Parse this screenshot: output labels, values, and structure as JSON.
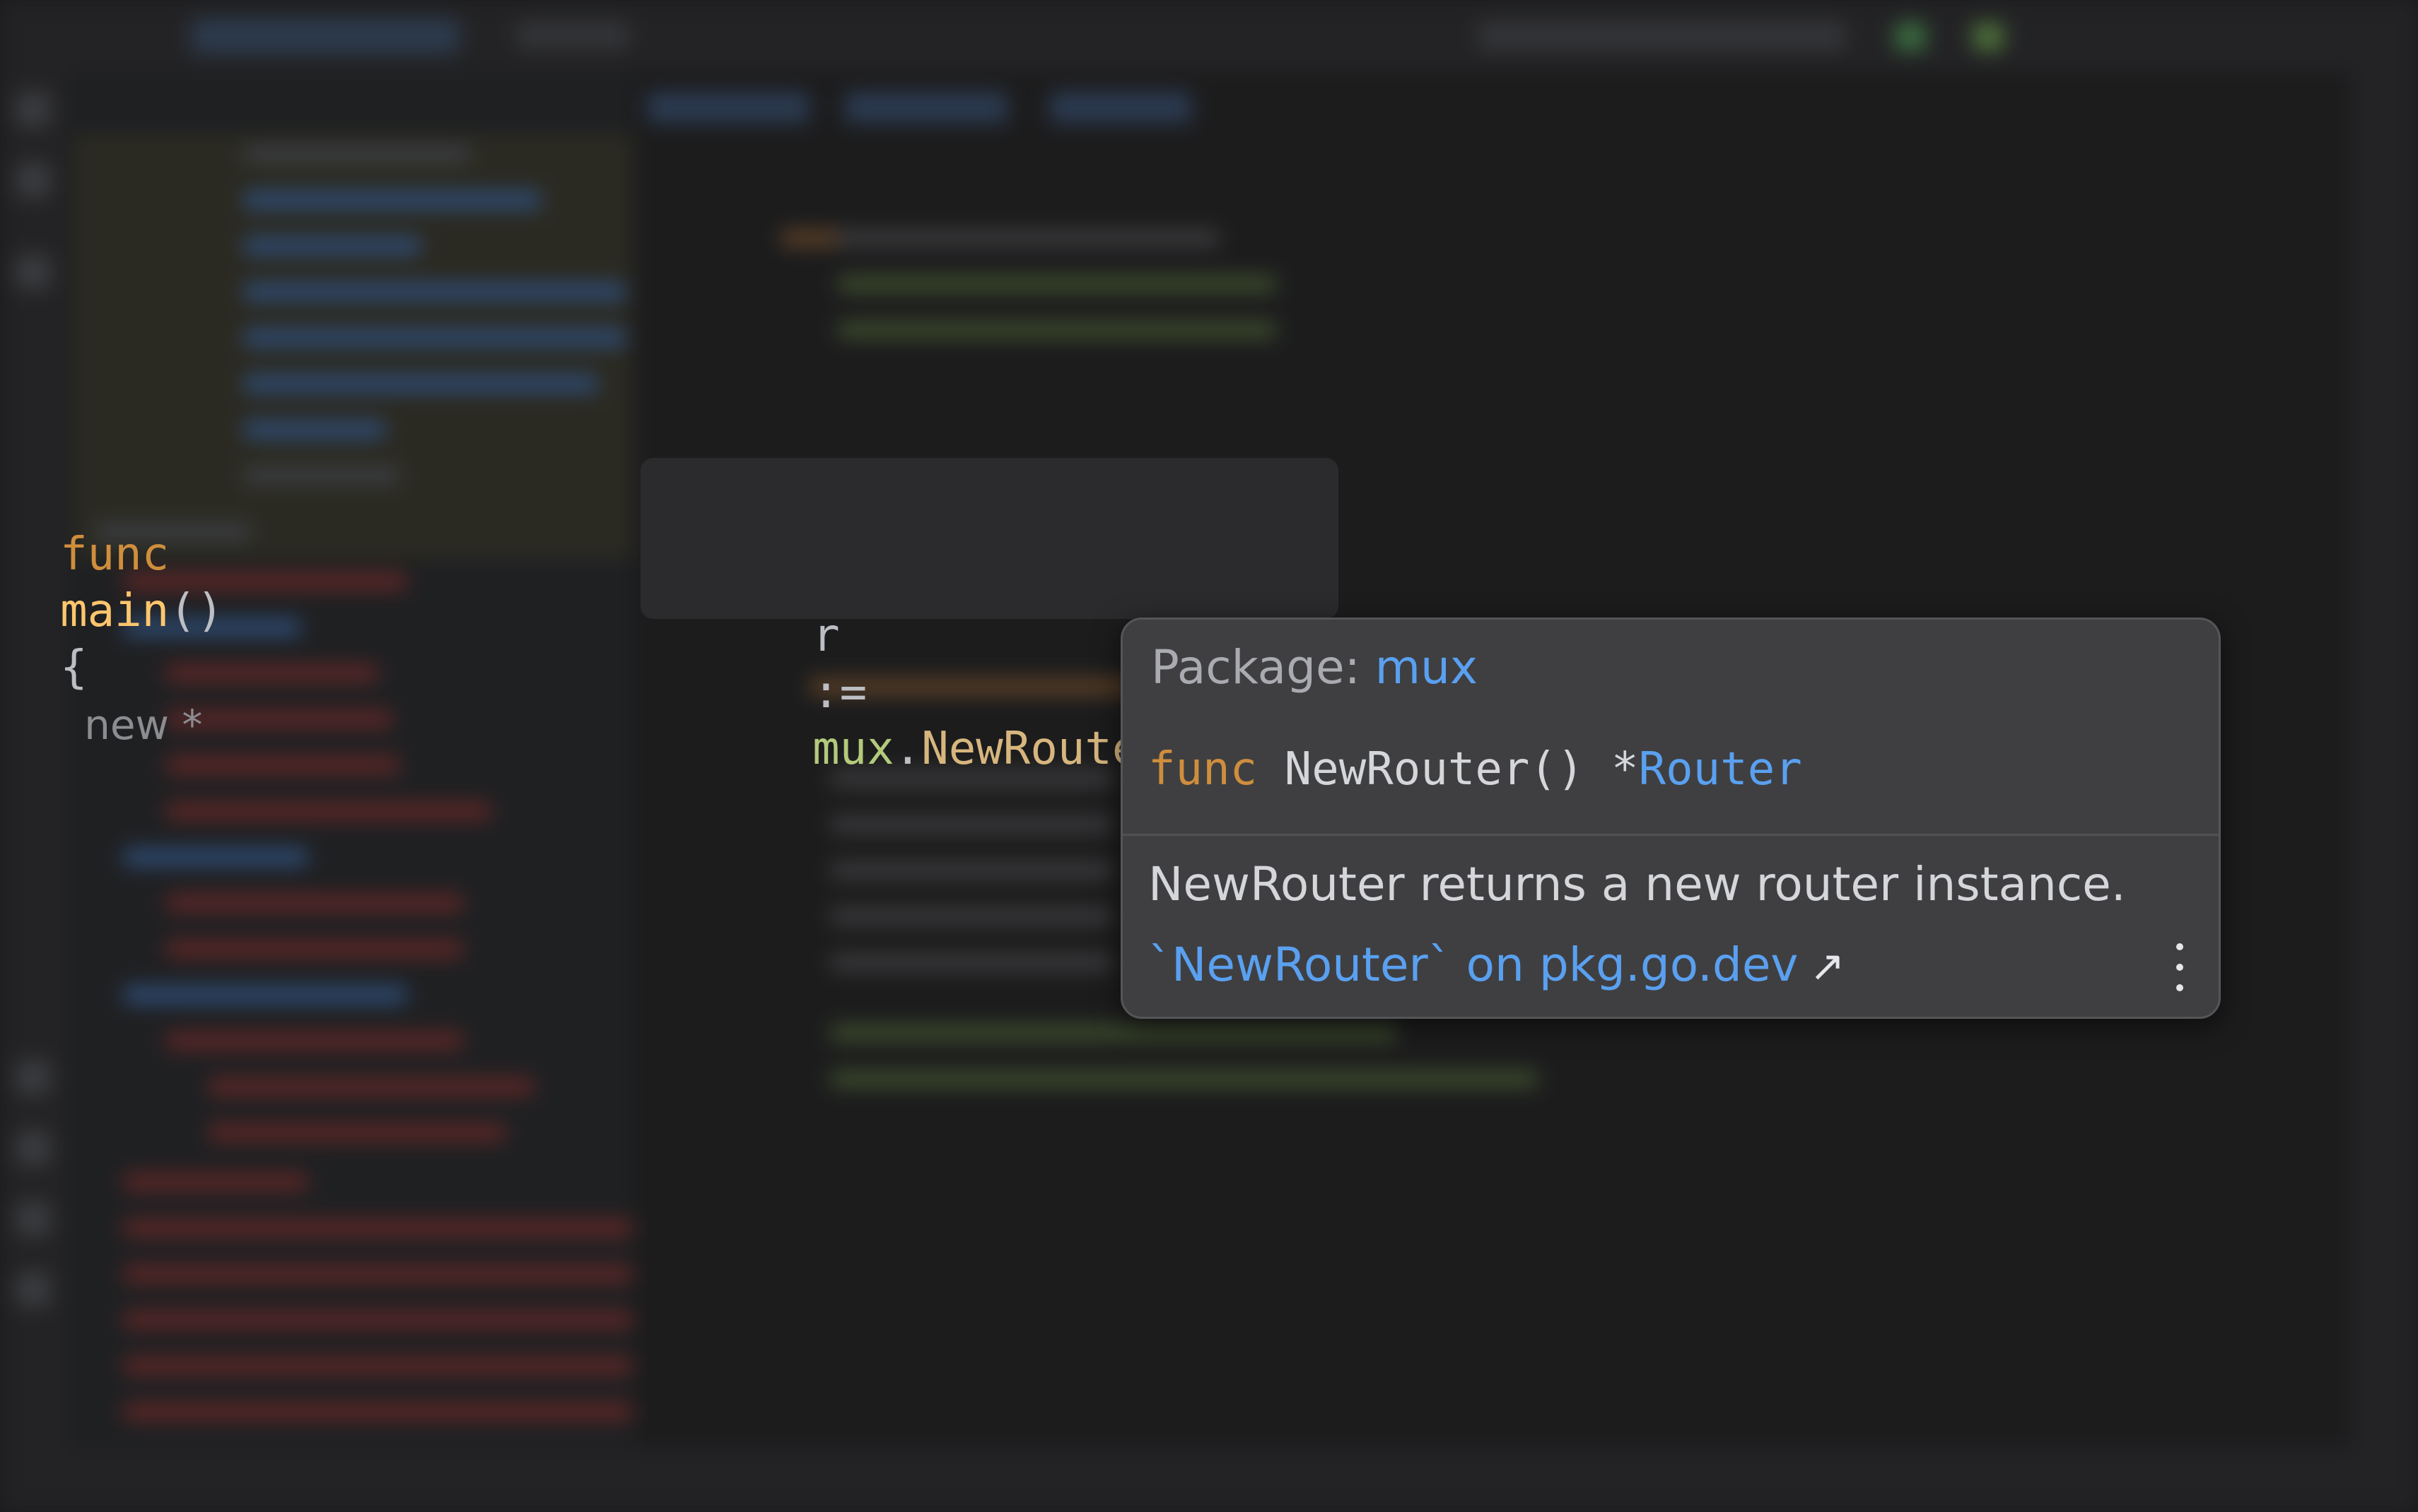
{
  "code_snippet": {
    "line1": {
      "keyword": "func",
      "name": "main",
      "parens": "()",
      "brace": "{",
      "inlay_hint": "new *"
    },
    "line2": {
      "var": "r",
      "operator": ":=",
      "package": "mux",
      "dot": ".",
      "call": "NewRouter",
      "parens": "()"
    }
  },
  "doc_popup": {
    "package_label": "Package:",
    "package_name": "mux",
    "signature": {
      "keyword": "func",
      "name": "NewRouter() *",
      "return_type": "Router"
    },
    "description": "NewRouter returns a new router instance.",
    "link_text": "`NewRouter` on pkg.go.dev",
    "link_icon": "external-link-icon",
    "menu_icon": "more-vertical-icon"
  },
  "colors": {
    "keyword": "#cf8e3d",
    "function_decl": "#ffc66d",
    "package": "#b3ca7b",
    "link": "#5aa0f0",
    "popup_bg": "#3f3f41",
    "editor_bg": "#1c1c1d"
  }
}
